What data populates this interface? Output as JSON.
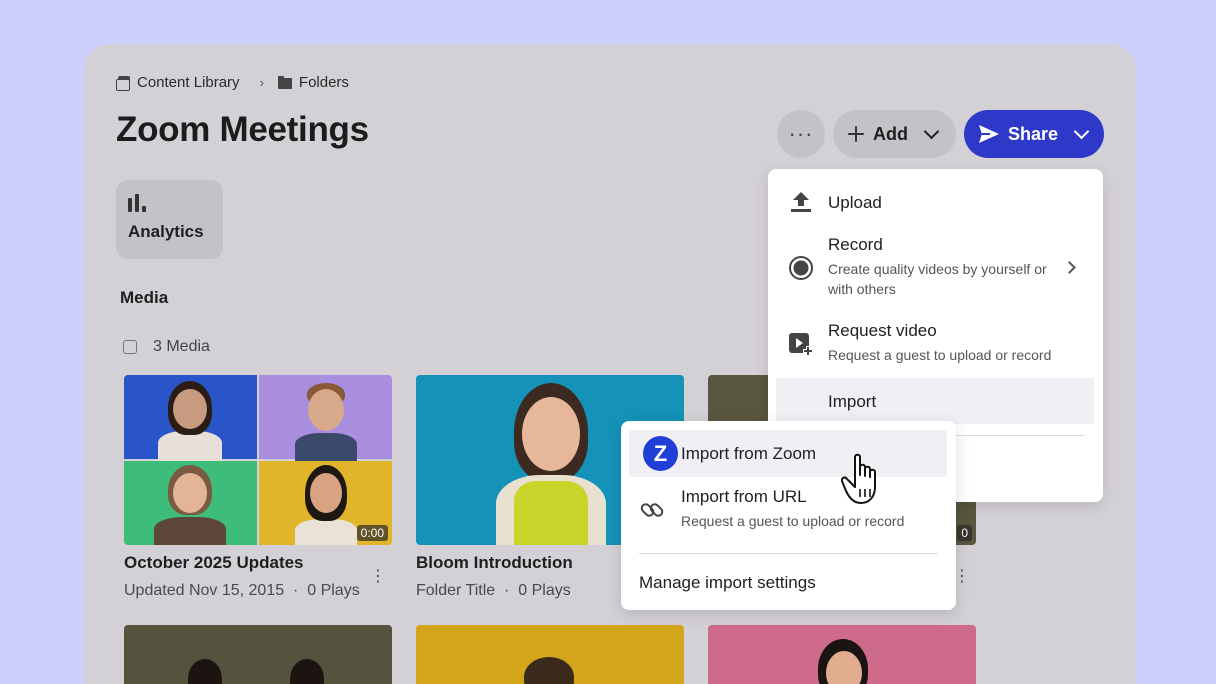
{
  "breadcrumb": {
    "library": "Content Library",
    "folders": "Folders",
    "separator": "›"
  },
  "header": {
    "title": "Zoom Meetings",
    "more_label": "···",
    "add_label": "Add",
    "share_label": "Share"
  },
  "analytics": {
    "label": "Analytics"
  },
  "media": {
    "section_title": "Media",
    "count_label": "3 Media"
  },
  "cards": [
    {
      "title": "October 2025 Updates",
      "meta": "Updated Nov 15, 2015  ·  0 Plays",
      "duration": "0:00"
    },
    {
      "title": "Bloom Introduction",
      "meta": "Folder Title  ·  0 Plays",
      "duration": ""
    },
    {
      "title": "",
      "meta": "",
      "duration": "0"
    }
  ],
  "add_menu": {
    "upload": {
      "label": "Upload"
    },
    "record": {
      "label": "Record",
      "desc": "Create quality videos by yourself or with others"
    },
    "request": {
      "label": "Request video",
      "desc": "Request a guest to upload or record"
    },
    "import": {
      "label": "Import"
    }
  },
  "import_menu": {
    "zoom": {
      "label": "Import from Zoom",
      "icon_letter": "Z"
    },
    "url": {
      "label": "Import from URL",
      "desc": "Request a guest to upload or record"
    },
    "manage": {
      "label": "Manage import settings"
    }
  },
  "colors": {
    "background": "#cfcffb",
    "panel": "#d4d1d6",
    "accent": "#2f39c9",
    "zoom_blue": "#1f3fd6"
  },
  "icons": [
    "library-icon",
    "folder-icon",
    "more-icon",
    "plus-icon",
    "chevron-down-icon",
    "send-icon",
    "analytics-icon",
    "upload-icon",
    "record-icon",
    "request-video-icon",
    "chevron-right-icon",
    "zoom-icon",
    "link-icon",
    "hand-cursor-icon"
  ]
}
